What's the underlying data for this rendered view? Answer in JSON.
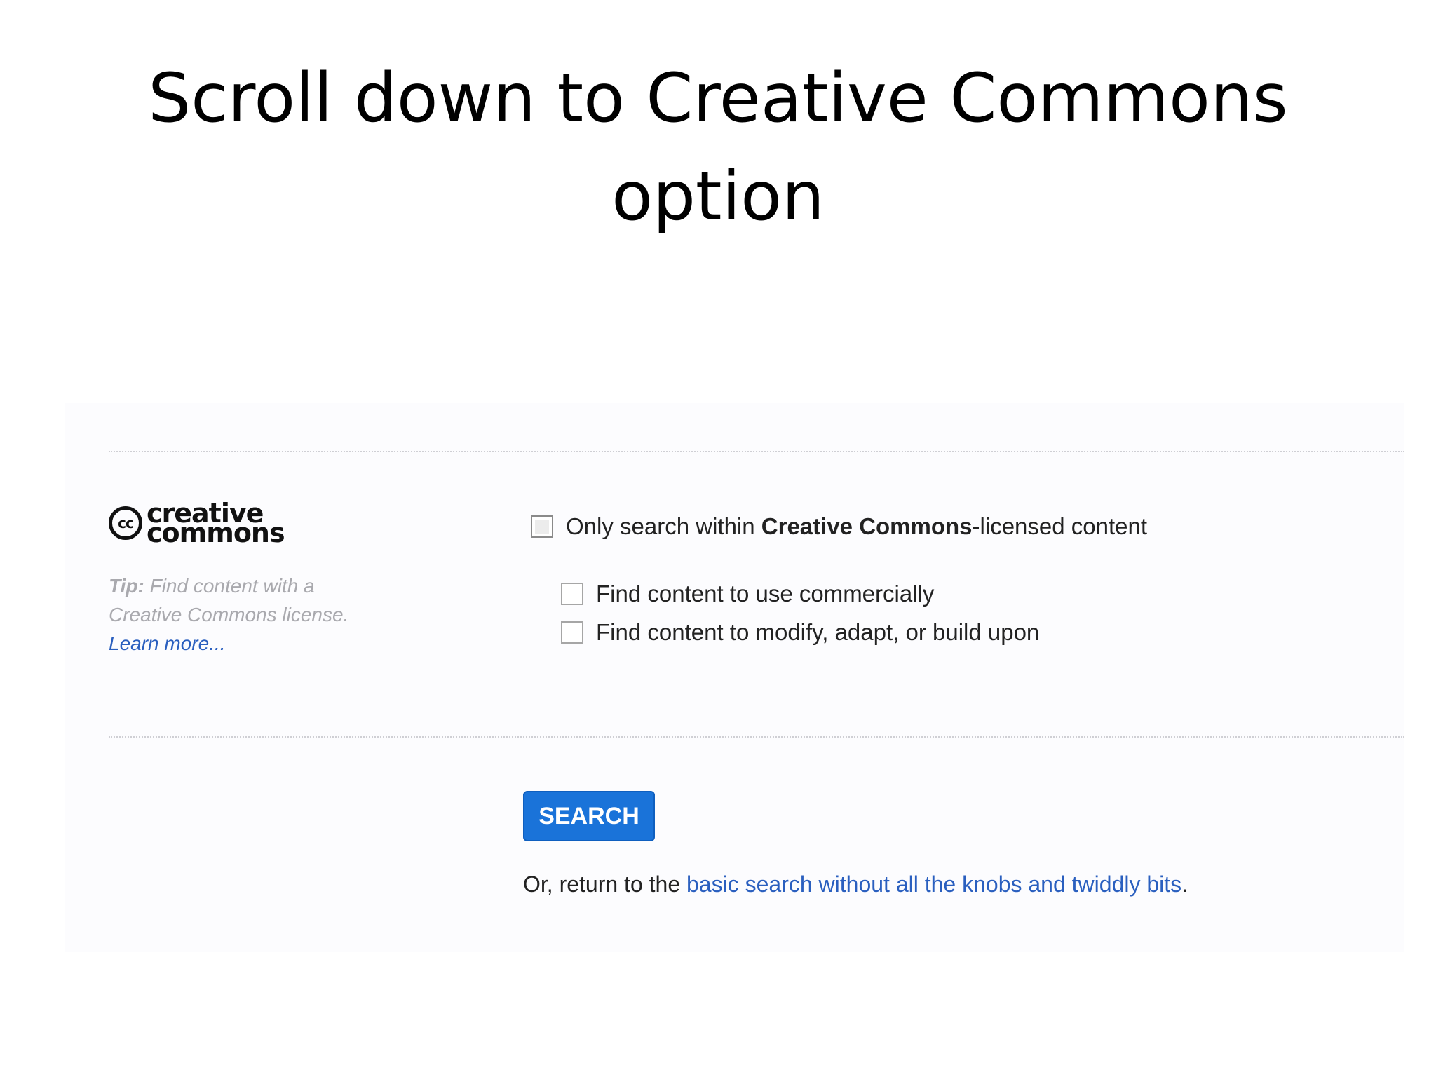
{
  "slide": {
    "title_line1": "Scroll down to Creative Commons",
    "title_line2": "option"
  },
  "cc_section": {
    "logo_mark": "cc",
    "logo_word1": "creative",
    "logo_word2": "commons",
    "tip_label": "Tip:",
    "tip_text_1": "Find content with a",
    "tip_text_2": "Creative Commons license.",
    "learn_more": "Learn more...",
    "main_checkbox": {
      "label_before": "Only search within ",
      "label_bold": "Creative Commons",
      "label_after": "-licensed content",
      "checked": false
    },
    "options": [
      {
        "label": "Find content to use commercially",
        "checked": false
      },
      {
        "label": "Find content to modify, adapt, or build upon",
        "checked": false
      }
    ]
  },
  "search": {
    "button_label": "SEARCH",
    "return_prefix": "Or, return to the ",
    "return_link": "basic search without all the knobs and twiddly bits",
    "return_suffix": "."
  },
  "colors": {
    "link": "#2a5fbf",
    "button": "#1a73d9",
    "tip_text": "#a9a9ae"
  }
}
